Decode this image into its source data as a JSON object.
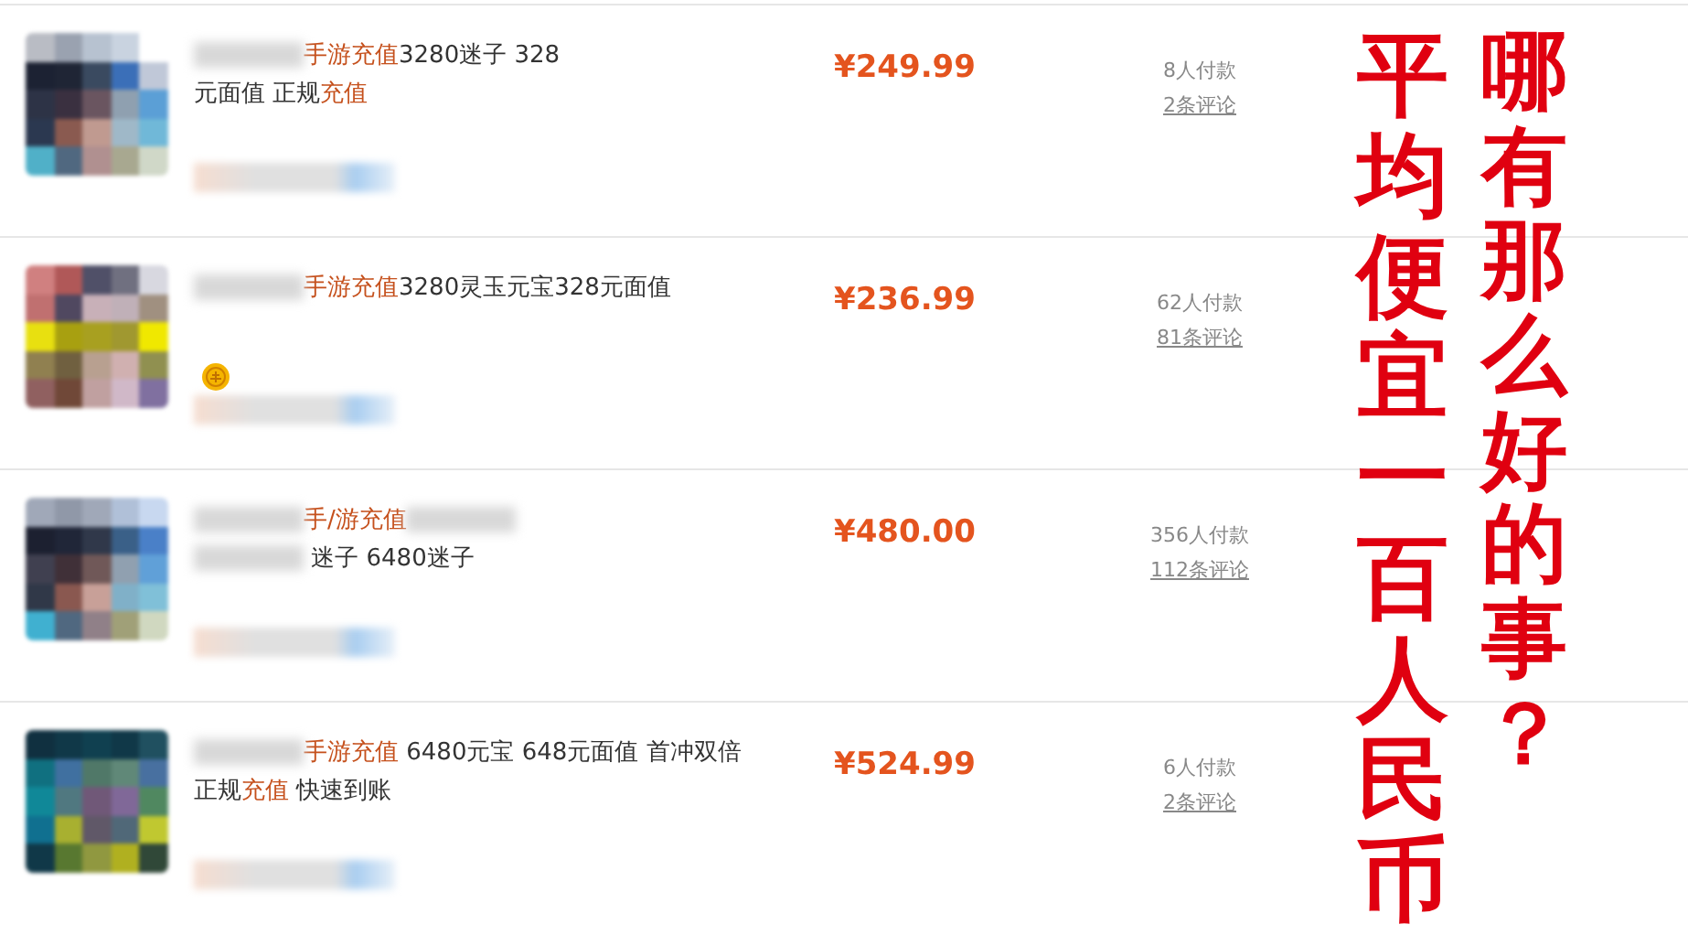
{
  "listings": [
    {
      "title": [
        {
          "kind": "blur_long"
        },
        {
          "kind": "highlight",
          "text": "手游充值"
        },
        {
          "kind": "text",
          "text": "3280迷子 328"
        },
        {
          "kind": "break"
        },
        {
          "kind": "text",
          "text": "元面值 正规"
        },
        {
          "kind": "highlight",
          "text": "充值"
        }
      ],
      "coin_badge": false,
      "price": "¥249.99",
      "sales": "8人付款",
      "reviews": "2条评论"
    },
    {
      "title": [
        {
          "kind": "blur_short"
        },
        {
          "kind": "highlight",
          "text": "手游充值"
        },
        {
          "kind": "text",
          "text": "3280灵玉元宝328元面值"
        }
      ],
      "coin_badge": true,
      "price": "¥236.99",
      "sales": "62人付款",
      "reviews": "81条评论"
    },
    {
      "title": [
        {
          "kind": "blur_long"
        },
        {
          "kind": "highlight",
          "text": "手/游充值"
        },
        {
          "kind": "blur_long"
        },
        {
          "kind": "break"
        },
        {
          "kind": "blur_short"
        },
        {
          "kind": "text",
          "text": " 迷子 6480迷子"
        }
      ],
      "coin_badge": false,
      "price": "¥480.00",
      "sales": "356人付款",
      "reviews": "112条评论"
    },
    {
      "title": [
        {
          "kind": "blur_medium"
        },
        {
          "kind": "highlight",
          "text": "手游充值"
        },
        {
          "kind": "text",
          "text": " 6480元宝 648元面值 首冲双倍"
        },
        {
          "kind": "break"
        },
        {
          "kind": "text",
          "text": "正规"
        },
        {
          "kind": "highlight",
          "text": "充值"
        },
        {
          "kind": "text",
          "text": " 快速到账"
        }
      ],
      "coin_badge": false,
      "price": "¥524.99",
      "sales": "6人付款",
      "reviews": "2条评论"
    }
  ],
  "captions": [
    "平均便宜一百人民币",
    "哪有那么好的事？"
  ]
}
